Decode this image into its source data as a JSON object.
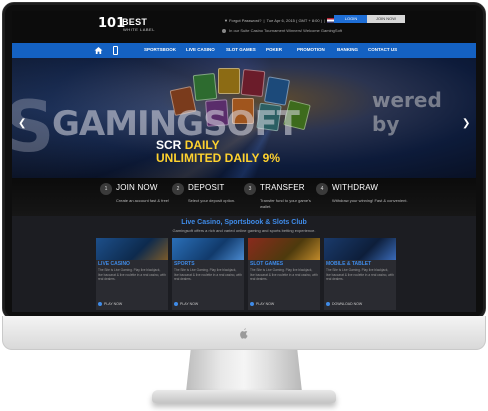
{
  "header": {
    "logo_number": "101",
    "logo_best": "BEST",
    "logo_subtitle": "WHITE LABEL",
    "forgot_password": "▼ Forgot Password?",
    "datetime": "Tue Apr 6, 2015 ( GMT + 8:00 )",
    "ticker_text": "In our Suite Casino Tournament Winners! Welcome GamingSoft",
    "login_label": "LOGIN",
    "join_label": "JOIN NOW"
  },
  "nav": {
    "items": [
      "SPORTSBOOK",
      "LIVE CASINO",
      "SLOT GAMES",
      "POKER",
      "PROMOTION",
      "BANKING",
      "CONTACT US"
    ]
  },
  "banner": {
    "promo_line1_prefix": "SCR",
    "promo_line1_suffix": "DAILY",
    "promo_line2": "UNLIMITED DAILY 9%",
    "watermark_left": "GAMINGSOFT",
    "watermark_right": "wered by"
  },
  "steps": [
    {
      "num": "1",
      "title": "JOIN NOW",
      "desc": "Create an account fast & free!"
    },
    {
      "num": "2",
      "title": "DEPOSIT",
      "desc": "Select your deposit option."
    },
    {
      "num": "3",
      "title": "TRANSFER",
      "desc": "Transfer fund to your game's wallet."
    },
    {
      "num": "4",
      "title": "WITHDRAW",
      "desc": "Withdraw your winning! Fast & convenient."
    }
  ],
  "club": {
    "title": "Live Casino, Sportsbook & Slots Club",
    "subtitle": "Gamingsoft offers a rich and varied online gaming and sports betting experience.",
    "cards": [
      {
        "label": "LIVE CASINO",
        "text": "The Site is Live Gaming. Play live blackjack, live baccarat & live roulette in a real casino, with real dealers.",
        "play": "PLAY NOW"
      },
      {
        "label": "SPORTS",
        "text": "The Site is Live Gaming. Play live blackjack, live baccarat & live roulette in a real casino, with real dealers.",
        "play": "PLAY NOW"
      },
      {
        "label": "SLOT GAMES",
        "text": "The Site is Live Gaming. Play live blackjack, live baccarat & live roulette in a real casino, with real dealers.",
        "play": "PLAY NOW"
      },
      {
        "label": "MOBILE & TABLET",
        "text": "The Site is Live Gaming. Play live blackjack, live baccarat & live roulette in a real casino, with real dealers.",
        "play": "DOWNLOAD NOW"
      }
    ]
  },
  "colors": {
    "nav_blue": "#1461c2",
    "accent_yellow": "#ffd22e",
    "link_blue": "#3f8be8"
  }
}
